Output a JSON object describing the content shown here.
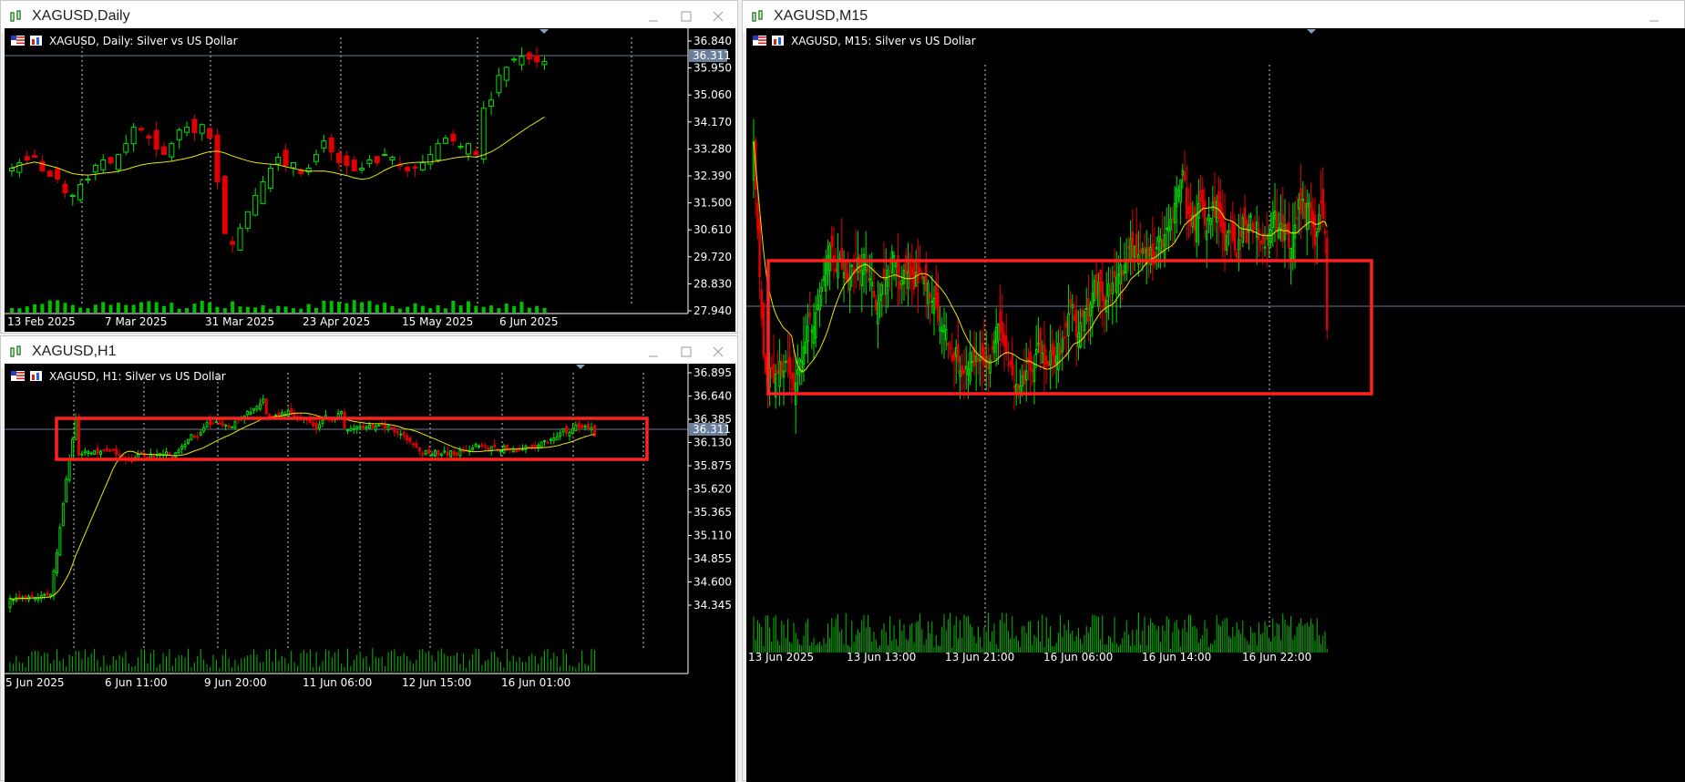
{
  "colors": {
    "bull": "#00e000",
    "bear": "#e00000",
    "ma": "#e6e600",
    "grid": "#ffffff",
    "bid": "#6a7d99",
    "highlight": "#ff2020",
    "volume": "#00c000"
  },
  "windows": [
    {
      "id": "daily",
      "title": "XAGUSD,Daily",
      "chart_caption": "XAGUSD, Daily:  Silver vs US Dollar",
      "price_tag": "36.311",
      "y_ticks": [
        "36.840",
        "35.950",
        "35.060",
        "34.170",
        "33.280",
        "32.390",
        "31.500",
        "30.610",
        "29.720",
        "28.830",
        "27.940"
      ],
      "x_ticks": [
        "13 Feb 2025",
        "7 Mar 2025",
        "31 Mar 2025",
        "23 Apr 2025",
        "15 May 2025",
        "6 Jun 2025"
      ],
      "icons": [
        "flag-icon",
        "chart-type-icon"
      ]
    },
    {
      "id": "h1",
      "title": "XAGUSD,H1",
      "chart_caption": "XAGUSD, H1:  Silver vs US Dollar",
      "price_tag": "36.311",
      "y_ticks": [
        "36.895",
        "36.640",
        "36.385",
        "36.130",
        "35.875",
        "35.620",
        "35.365",
        "35.110",
        "34.855",
        "34.600",
        "34.345"
      ],
      "x_ticks": [
        "5 Jun 2025",
        "6 Jun 11:00",
        "9 Jun 20:00",
        "11 Jun 06:00",
        "12 Jun 15:00",
        "16 Jun 01:00"
      ]
    },
    {
      "id": "m15",
      "title": "XAGUSD,M15",
      "chart_caption": "XAGUSD, M15:  Silver vs US Dollar",
      "x_ticks": [
        "13 Jun 2025",
        "13 Jun 13:00",
        "13 Jun 21:00",
        "16 Jun 06:00",
        "16 Jun 14:00",
        "16 Jun 22:00"
      ]
    }
  ],
  "chart_data": [
    {
      "type": "candlestick",
      "title": "XAGUSD, Daily:  Silver vs US Dollar",
      "ylim": [
        27.5,
        37.2
      ],
      "closes": [
        32.4,
        32.6,
        32.7,
        32.8,
        32.3,
        32.1,
        32.0,
        31.5,
        31.4,
        31.8,
        32.0,
        32.5,
        32.7,
        32.6,
        32.9,
        33.3,
        33.9,
        33.8,
        33.5,
        33.1,
        32.9,
        33.3,
        33.8,
        33.9,
        33.7,
        34.0,
        33.5,
        31.9,
        30.0,
        29.6,
        30.2,
        30.8,
        31.4,
        31.9,
        32.4,
        32.8,
        32.5,
        32.6,
        32.2,
        32.4,
        32.9,
        33.4,
        33.0,
        32.6,
        32.5,
        32.3,
        32.4,
        32.7,
        32.6,
        32.9,
        32.8,
        32.5,
        32.3,
        32.4,
        32.6,
        32.9,
        33.3,
        33.5,
        33.4,
        33.2,
        33.3,
        32.9,
        34.6,
        34.9,
        35.8,
        36.1,
        36.4,
        36.5,
        36.4,
        36.3,
        36.311
      ],
      "ma_end": 35.0
    },
    {
      "type": "candlestick",
      "title": "XAGUSD, H1:  Silver vs US Dollar",
      "ylim": [
        34.2,
        37.0
      ]
    },
    {
      "type": "candlestick",
      "title": "XAGUSD, M15:  Silver vs US Dollar"
    }
  ]
}
